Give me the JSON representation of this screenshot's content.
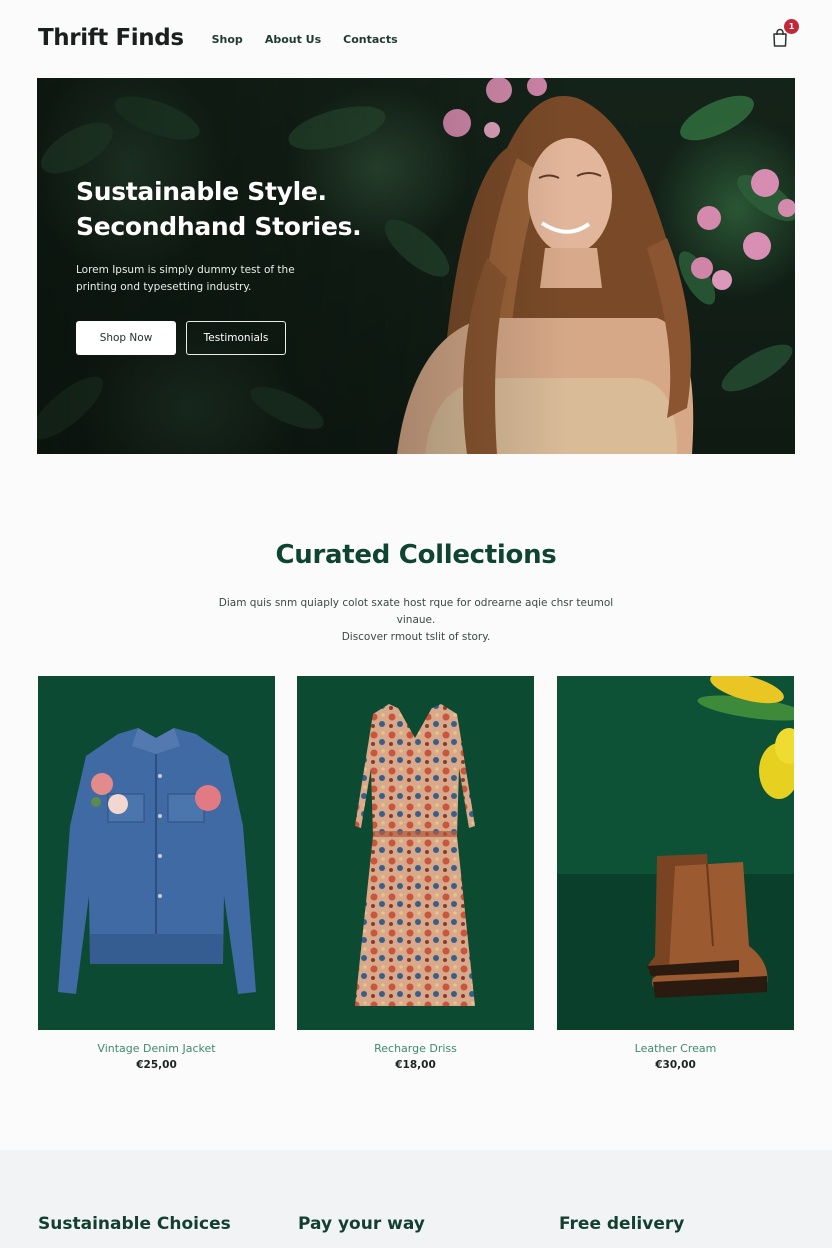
{
  "header": {
    "logo": "Thrift Finds",
    "nav": [
      "Shop",
      "About Us",
      "Contacts"
    ],
    "cart_count": "1"
  },
  "hero": {
    "title_line1": "Sustainable Style.",
    "title_line2": "Secondhand Stories.",
    "subtitle": "Lorem Ipsum is simply dummy test of the printing ond typesetting industry.",
    "primary_button": "Shop Now",
    "secondary_button": "Testimonials"
  },
  "collections": {
    "title": "Curated Collections",
    "description_line1": "Diam quis snm quiaply colot sxate host rque for odrearne aqie chsr teumol vinaue.",
    "description_line2": "Discover rmout tslit of story.",
    "products": [
      {
        "name": "Vintage Denim Jacket",
        "price": "€25,00"
      },
      {
        "name": "Recharge Driss",
        "price": "€18,00"
      },
      {
        "name": "Leather Cream",
        "price": "€30,00"
      }
    ]
  },
  "features": [
    "Sustainable Choices",
    "Pay your way",
    "Free delivery"
  ],
  "colors": {
    "brand_green": "#0f4432",
    "product_bg": "#0d4a33",
    "badge_red": "#c3273a"
  }
}
